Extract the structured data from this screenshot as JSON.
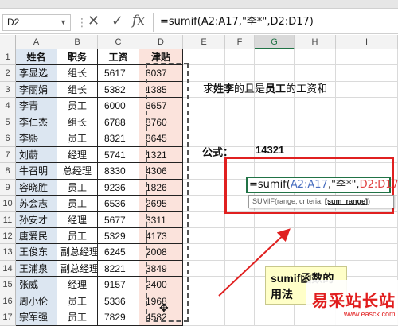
{
  "name_box": {
    "value": "D2"
  },
  "formula_bar": {
    "cancel_glyph": "✕",
    "enter_glyph": "✓",
    "fx_glyph": "fx",
    "content": "=sumif(A2:A17,\"李*\",D2:D17)"
  },
  "columns": [
    "A",
    "B",
    "C",
    "D",
    "E",
    "F",
    "G",
    "H",
    "I"
  ],
  "selected_column": "G",
  "row_numbers": [
    "1",
    "2",
    "3",
    "4",
    "5",
    "6",
    "7",
    "8",
    "9",
    "10",
    "11",
    "12",
    "13",
    "14",
    "15",
    "16",
    "17"
  ],
  "table": {
    "headers": [
      "姓名",
      "职务",
      "工资",
      "津贴"
    ],
    "rows": [
      [
        "李显选",
        "组长",
        "5617",
        "3037"
      ],
      [
        "李丽娟",
        "组长",
        "5382",
        "1385"
      ],
      [
        "李青",
        "员工",
        "6000",
        "3657"
      ],
      [
        "李仁杰",
        "组长",
        "6788",
        "3760"
      ],
      [
        "李熙",
        "员工",
        "8321",
        "3645"
      ],
      [
        "刘蔚",
        "经理",
        "5741",
        "1321"
      ],
      [
        "牛召明",
        "总经理",
        "8330",
        "4306"
      ],
      [
        "容晓胜",
        "员工",
        "9236",
        "1826"
      ],
      [
        "苏会志",
        "员工",
        "6536",
        "2695"
      ],
      [
        "孙安才",
        "经理",
        "5677",
        "3311"
      ],
      [
        "唐爱民",
        "员工",
        "5329",
        "4173"
      ],
      [
        "王俊东",
        "副总经理",
        "6245",
        "2008"
      ],
      [
        "王浦泉",
        "副总经理",
        "8221",
        "3849"
      ],
      [
        "张威",
        "经理",
        "9157",
        "2400"
      ],
      [
        "周小伦",
        "员工",
        "5336",
        "1968"
      ],
      [
        "宗军强",
        "员工",
        "7829",
        "4582"
      ]
    ]
  },
  "note": {
    "prefix": "求",
    "highlight1": "姓李",
    "middle": "的且是",
    "highlight2": "员工",
    "suffix": "的工资和"
  },
  "formula_result": {
    "label": "公式：",
    "value": "14321"
  },
  "in_cell_edit": {
    "prefix": "=sumif(",
    "range1": "A2:A17",
    "criteria": ",\"李*\",",
    "range2": "D2:D17",
    "suffix": ")"
  },
  "tooltip": {
    "text": "SUMIF(range, criteria, ",
    "optional": "[sum_range]",
    "close": ")"
  },
  "callout": {
    "text": "sumif函数的\n用法"
  },
  "watermark": {
    "text": "易采站长站",
    "url": "www.easck.com"
  },
  "colors": {
    "accent_green": "#217346",
    "name_column_fill": "#dce6f1",
    "allowance_column_fill": "#fbe3dc",
    "annotation_red": "#e02020"
  }
}
